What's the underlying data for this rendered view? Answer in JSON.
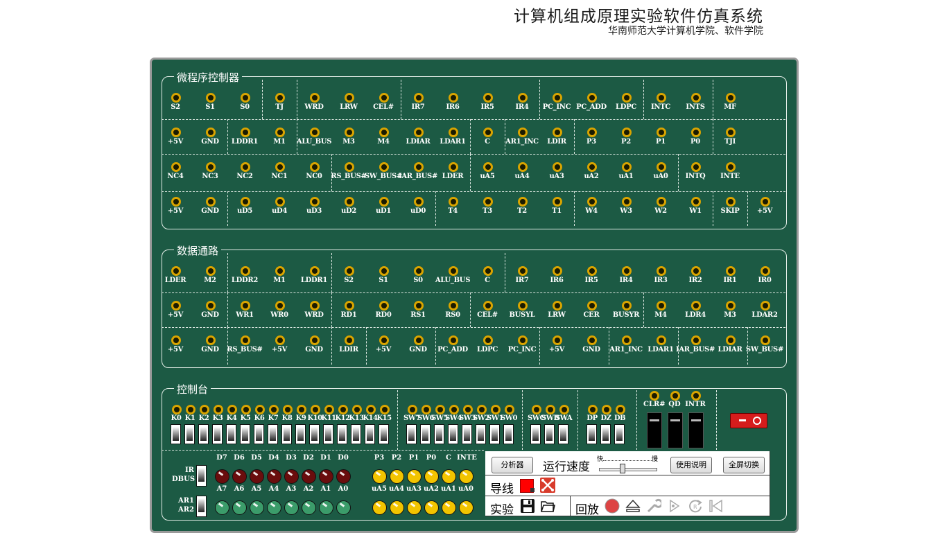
{
  "header": {
    "title": "计算机组成原理实验软件仿真系统",
    "subtitle": "华南师范大学计算机学院、软件学院"
  },
  "micro": {
    "title": "微程序控制器",
    "rows": [
      [
        "S2",
        "S1",
        "S0",
        "TJ",
        "WRD",
        "LRW",
        "CEL#",
        "IR7",
        "IR6",
        "IR5",
        "IR4",
        "PC_INC",
        "PC_ADD",
        "LDPC",
        "INTC",
        "INTS",
        "MF"
      ],
      [
        "+5V",
        "GND",
        "LDDR1",
        "M1",
        "ALU_BUS",
        "M3",
        "M4",
        "LDIAR",
        "LDAR1",
        "C",
        "AR1_INC",
        "LDIR",
        "P3",
        "P2",
        "P1",
        "P0",
        "TJI"
      ],
      [
        "NC4",
        "NC3",
        "NC2",
        "NC1",
        "NC0",
        "RS_BUS#",
        "SW_BUS#",
        "IAR_BUS#",
        "LDER",
        "uA5",
        "uA4",
        "uA3",
        "uA2",
        "uA1",
        "uA0",
        "INTQ",
        "INTE"
      ],
      [
        "+5V",
        "GND",
        "uD5",
        "uD4",
        "uD3",
        "uD2",
        "uD1",
        "uD0",
        "T4",
        "T3",
        "T2",
        "T1",
        "W4",
        "W3",
        "W2",
        "W1",
        "SKIP",
        "+5V"
      ]
    ]
  },
  "datapath": {
    "title": "数据通路",
    "rows": [
      [
        "LDER",
        "M2",
        "LDDR2",
        "M1",
        "LDDR1",
        "S2",
        "S1",
        "S0",
        "ALU_BUS",
        "C",
        "IR7",
        "IR6",
        "IR5",
        "IR4",
        "IR3",
        "IR2",
        "IR1",
        "IR0"
      ],
      [
        "+5V",
        "GND",
        "WR1",
        "WR0",
        "WRD",
        "RD1",
        "RD0",
        "RS1",
        "RS0",
        "CEL#",
        "BUSYL",
        "LRW",
        "CER",
        "BUSYR",
        "M4",
        "LDR4",
        "M3",
        "LDAR2"
      ],
      [
        "+5V",
        "GND",
        "RS_BUS#",
        "+5V",
        "GND",
        "LDIR",
        "+5V",
        "GND",
        "PC_ADD",
        "LDPC",
        "PC_INC",
        "+5V",
        "GND",
        "AR1_INC",
        "LDAR1",
        "IAR_BUS#",
        "LDIAR",
        "SW_BUS#"
      ]
    ]
  },
  "console": {
    "title": "控制台",
    "k_switches": [
      "K0",
      "K1",
      "K2",
      "K3",
      "K4",
      "K5",
      "K6",
      "K7",
      "K8",
      "K9",
      "K10",
      "K11",
      "K12",
      "K13",
      "K14",
      "K15"
    ],
    "sw_switches": [
      "SW7",
      "SW6",
      "SW5",
      "SW4",
      "SW3",
      "SW2",
      "SW1",
      "SW0"
    ],
    "mode_switches": [
      "SWC",
      "SWB",
      "SWA"
    ],
    "d_switches": [
      "DP",
      "DZ",
      "DB"
    ],
    "buttons": [
      "CLR#",
      "QD",
      "INTR"
    ],
    "ir_dbus": "IR\nDBUS",
    "ar1_ar2": "AR1\nAR2",
    "d_leds": [
      "D7",
      "D6",
      "D5",
      "D4",
      "D3",
      "D2",
      "D1",
      "D0"
    ],
    "a_leds": [
      "A7",
      "A6",
      "A5",
      "A4",
      "A3",
      "A2",
      "A1",
      "A0"
    ],
    "p_leds": [
      "P3",
      "P2",
      "P1",
      "P0",
      "C",
      "INTE"
    ],
    "ua_leds": [
      "uA5",
      "uA4",
      "uA3",
      "uA2",
      "uA1",
      "uA0"
    ]
  },
  "controls": {
    "analyzer_btn": "分析器",
    "speed_label": "运行速度",
    "speed_fast": "快",
    "speed_slow": "慢",
    "speed_value": 0.4,
    "help_btn": "使用说明",
    "fullscreen_btn": "全屏切换",
    "wire_label": "导线",
    "experiment_label": "实验",
    "replay_label": "回放"
  },
  "colors": {
    "board": "#1c5a44",
    "pin_ring": "#d9a400",
    "led_red": "#6a0d0d",
    "led_green": "#3b9c6a",
    "led_yellow": "#f2c400",
    "power_switch": "#d61c1c",
    "wire_red": "#ff0000"
  }
}
